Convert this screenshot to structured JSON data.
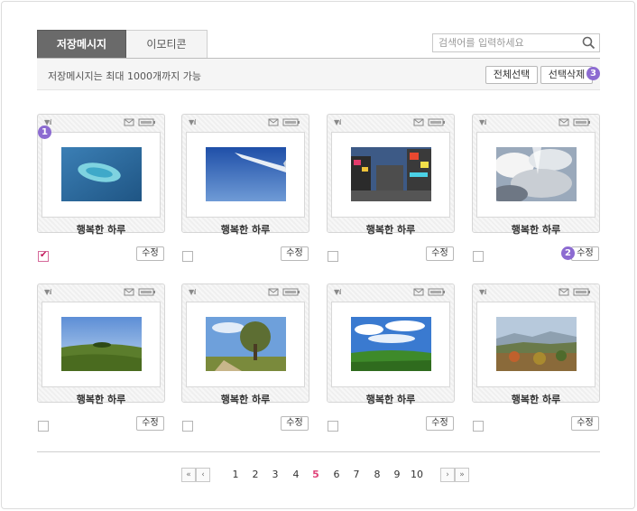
{
  "tabs": [
    {
      "label": "저장메시지",
      "active": true
    },
    {
      "label": "이모티콘",
      "active": false
    }
  ],
  "search": {
    "placeholder": "검색어를 입력하세요",
    "icon": "search-icon"
  },
  "info": {
    "text": "저장메시지는 최대 1000개까지 가능"
  },
  "toolbar": {
    "select_all": "전체선택",
    "delete_selected": "선택삭제"
  },
  "markers": {
    "m1": "1",
    "m2": "2",
    "m3": "3"
  },
  "messages": [
    {
      "title": "행복한 하루",
      "checked": true,
      "edit": "수정",
      "photo": "island-aerial"
    },
    {
      "title": "행복한 하루",
      "checked": false,
      "edit": "수정",
      "photo": "airplane-wing-sky"
    },
    {
      "title": "행복한 하루",
      "checked": false,
      "edit": "수정",
      "photo": "city-street-night"
    },
    {
      "title": "행복한 하루",
      "checked": false,
      "edit": "수정",
      "photo": "clouds-sunrays"
    },
    {
      "title": "행복한 하루",
      "checked": false,
      "edit": "수정",
      "photo": "green-hill-meadow"
    },
    {
      "title": "행복한 하루",
      "checked": false,
      "edit": "수정",
      "photo": "tree-field"
    },
    {
      "title": "행복한 하루",
      "checked": false,
      "edit": "수정",
      "photo": "grassland-clouds"
    },
    {
      "title": "행복한 하루",
      "checked": false,
      "edit": "수정",
      "photo": "autumn-mountains"
    }
  ],
  "pagination": {
    "first": "«",
    "prev": "‹",
    "next": "›",
    "last": "»",
    "pages": [
      "1",
      "2",
      "3",
      "4",
      "5",
      "6",
      "7",
      "8",
      "9",
      "10"
    ],
    "current": "5"
  },
  "colors": {
    "accent": "#e0457b",
    "marker": "#8c6bd1",
    "tab_active": "#6a6a6a"
  }
}
